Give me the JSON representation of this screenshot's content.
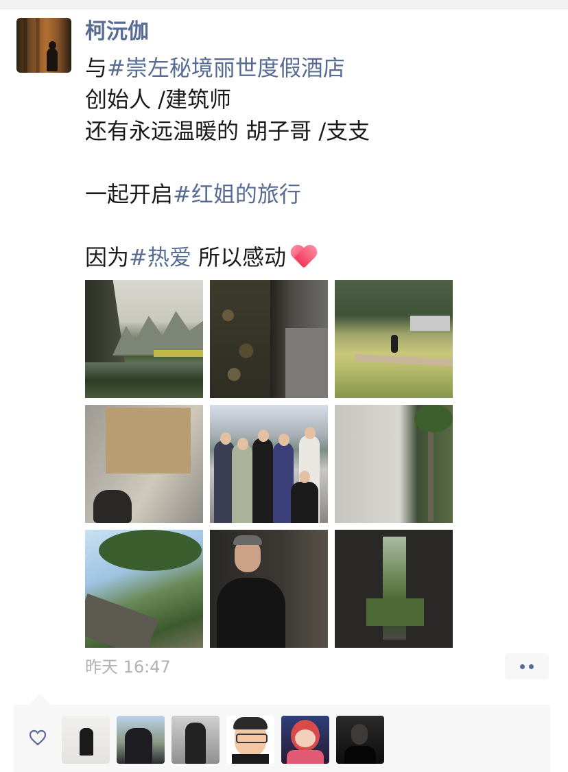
{
  "post": {
    "username": "柯沅伽",
    "lines": [
      [
        "与",
        "#崇左秘境丽世度假酒店"
      ],
      [
        "创始人 /建筑师"
      ],
      [
        "还有永远温暖的 胡子哥 /支支"
      ],
      [
        "一起开启",
        "#红姐的旅行"
      ],
      [
        "因为",
        "#热爱",
        " 所以感动"
      ]
    ],
    "line1_plain": "与",
    "line1_tag": "#崇左秘境丽世度假酒店",
    "line2": "创始人 /建筑师",
    "line3": "还有永远温暖的 胡子哥 /支支",
    "line4_plain": "一起开启",
    "line4_tag": "#红姐的旅行",
    "line5_plain": "因为",
    "line5_tag": "#热爱",
    "line5_rest": " 所以感动",
    "emoji": "heart-emoji",
    "timestamp": "昨天 16:47",
    "photo_count": 9,
    "likes_count": 6
  },
  "colors": {
    "link": "#576b95",
    "text": "#1a1a1a",
    "timestamp": "#b2b2b2",
    "likes_bg": "#f7f7f7"
  },
  "icons": {
    "more": "more-dots-icon",
    "like": "heart-outline-icon"
  }
}
